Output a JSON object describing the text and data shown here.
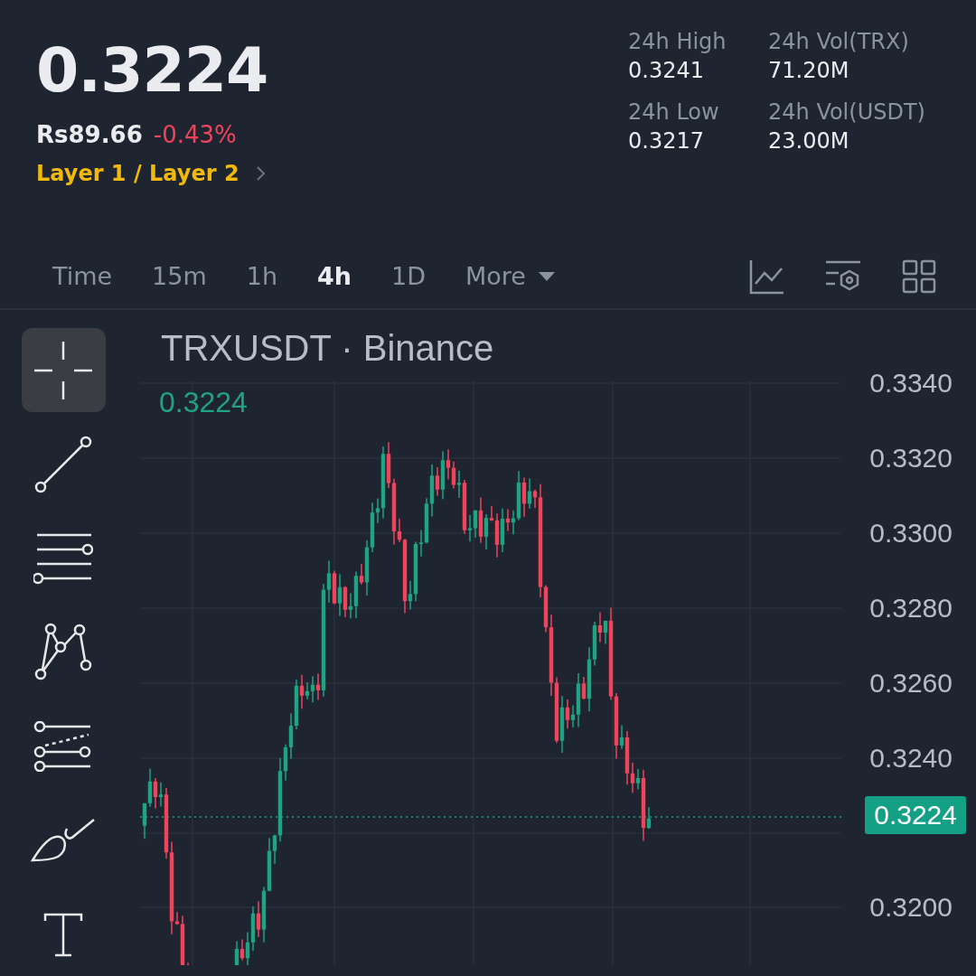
{
  "header": {
    "price": "0.3224",
    "fiat_price": "Rs89.66",
    "change": "-0.43%",
    "category": "Layer 1 / Layer 2"
  },
  "stats": [
    {
      "label": "24h High",
      "value": "0.3241"
    },
    {
      "label": "24h Vol(TRX)",
      "value": "71.20M"
    },
    {
      "label": "24h Low",
      "value": "0.3217"
    },
    {
      "label": "24h Vol(USDT)",
      "value": "23.00M"
    }
  ],
  "intervals": [
    {
      "label": "Time",
      "selected": false,
      "kind": "plain"
    },
    {
      "label": "15m",
      "selected": false,
      "kind": "plain"
    },
    {
      "label": "1h",
      "selected": false,
      "kind": "plain"
    },
    {
      "label": "4h",
      "selected": true,
      "kind": "plain"
    },
    {
      "label": "1D",
      "selected": false,
      "kind": "plain"
    },
    {
      "label": "More",
      "selected": false,
      "kind": "dropdown"
    }
  ],
  "drawing_tools": [
    {
      "kind": "crosshair",
      "selected": true
    },
    {
      "kind": "trend-line",
      "selected": false
    },
    {
      "kind": "parallel-lines",
      "selected": false
    },
    {
      "kind": "pattern",
      "selected": false
    },
    {
      "kind": "fib",
      "selected": false
    },
    {
      "kind": "brush",
      "selected": false
    },
    {
      "kind": "text",
      "selected": false
    }
  ],
  "chart": {
    "symbol": "TRXUSDT · Binance",
    "last_price": "0.3224",
    "price_tag": "0.3224",
    "price_axis_upper": [
      "0.3340",
      "0.3320",
      "0.3300",
      "0.3280",
      "0.3260",
      "0.3240"
    ],
    "price_axis_lower": [
      "0.3200"
    ]
  }
}
